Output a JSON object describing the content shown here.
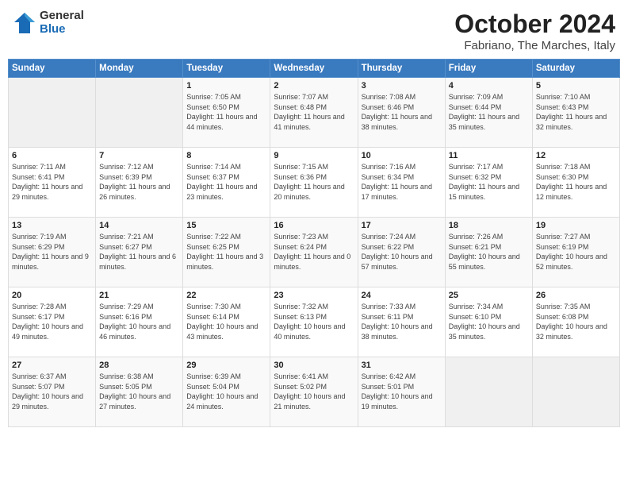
{
  "header": {
    "logo_general": "General",
    "logo_blue": "Blue",
    "month_title": "October 2024",
    "location": "Fabriano, The Marches, Italy"
  },
  "days_of_week": [
    "Sunday",
    "Monday",
    "Tuesday",
    "Wednesday",
    "Thursday",
    "Friday",
    "Saturday"
  ],
  "weeks": [
    [
      {
        "num": "",
        "sunrise": "",
        "sunset": "",
        "daylight": ""
      },
      {
        "num": "",
        "sunrise": "",
        "sunset": "",
        "daylight": ""
      },
      {
        "num": "1",
        "sunrise": "Sunrise: 7:05 AM",
        "sunset": "Sunset: 6:50 PM",
        "daylight": "Daylight: 11 hours and 44 minutes."
      },
      {
        "num": "2",
        "sunrise": "Sunrise: 7:07 AM",
        "sunset": "Sunset: 6:48 PM",
        "daylight": "Daylight: 11 hours and 41 minutes."
      },
      {
        "num": "3",
        "sunrise": "Sunrise: 7:08 AM",
        "sunset": "Sunset: 6:46 PM",
        "daylight": "Daylight: 11 hours and 38 minutes."
      },
      {
        "num": "4",
        "sunrise": "Sunrise: 7:09 AM",
        "sunset": "Sunset: 6:44 PM",
        "daylight": "Daylight: 11 hours and 35 minutes."
      },
      {
        "num": "5",
        "sunrise": "Sunrise: 7:10 AM",
        "sunset": "Sunset: 6:43 PM",
        "daylight": "Daylight: 11 hours and 32 minutes."
      }
    ],
    [
      {
        "num": "6",
        "sunrise": "Sunrise: 7:11 AM",
        "sunset": "Sunset: 6:41 PM",
        "daylight": "Daylight: 11 hours and 29 minutes."
      },
      {
        "num": "7",
        "sunrise": "Sunrise: 7:12 AM",
        "sunset": "Sunset: 6:39 PM",
        "daylight": "Daylight: 11 hours and 26 minutes."
      },
      {
        "num": "8",
        "sunrise": "Sunrise: 7:14 AM",
        "sunset": "Sunset: 6:37 PM",
        "daylight": "Daylight: 11 hours and 23 minutes."
      },
      {
        "num": "9",
        "sunrise": "Sunrise: 7:15 AM",
        "sunset": "Sunset: 6:36 PM",
        "daylight": "Daylight: 11 hours and 20 minutes."
      },
      {
        "num": "10",
        "sunrise": "Sunrise: 7:16 AM",
        "sunset": "Sunset: 6:34 PM",
        "daylight": "Daylight: 11 hours and 17 minutes."
      },
      {
        "num": "11",
        "sunrise": "Sunrise: 7:17 AM",
        "sunset": "Sunset: 6:32 PM",
        "daylight": "Daylight: 11 hours and 15 minutes."
      },
      {
        "num": "12",
        "sunrise": "Sunrise: 7:18 AM",
        "sunset": "Sunset: 6:30 PM",
        "daylight": "Daylight: 11 hours and 12 minutes."
      }
    ],
    [
      {
        "num": "13",
        "sunrise": "Sunrise: 7:19 AM",
        "sunset": "Sunset: 6:29 PM",
        "daylight": "Daylight: 11 hours and 9 minutes."
      },
      {
        "num": "14",
        "sunrise": "Sunrise: 7:21 AM",
        "sunset": "Sunset: 6:27 PM",
        "daylight": "Daylight: 11 hours and 6 minutes."
      },
      {
        "num": "15",
        "sunrise": "Sunrise: 7:22 AM",
        "sunset": "Sunset: 6:25 PM",
        "daylight": "Daylight: 11 hours and 3 minutes."
      },
      {
        "num": "16",
        "sunrise": "Sunrise: 7:23 AM",
        "sunset": "Sunset: 6:24 PM",
        "daylight": "Daylight: 11 hours and 0 minutes."
      },
      {
        "num": "17",
        "sunrise": "Sunrise: 7:24 AM",
        "sunset": "Sunset: 6:22 PM",
        "daylight": "Daylight: 10 hours and 57 minutes."
      },
      {
        "num": "18",
        "sunrise": "Sunrise: 7:26 AM",
        "sunset": "Sunset: 6:21 PM",
        "daylight": "Daylight: 10 hours and 55 minutes."
      },
      {
        "num": "19",
        "sunrise": "Sunrise: 7:27 AM",
        "sunset": "Sunset: 6:19 PM",
        "daylight": "Daylight: 10 hours and 52 minutes."
      }
    ],
    [
      {
        "num": "20",
        "sunrise": "Sunrise: 7:28 AM",
        "sunset": "Sunset: 6:17 PM",
        "daylight": "Daylight: 10 hours and 49 minutes."
      },
      {
        "num": "21",
        "sunrise": "Sunrise: 7:29 AM",
        "sunset": "Sunset: 6:16 PM",
        "daylight": "Daylight: 10 hours and 46 minutes."
      },
      {
        "num": "22",
        "sunrise": "Sunrise: 7:30 AM",
        "sunset": "Sunset: 6:14 PM",
        "daylight": "Daylight: 10 hours and 43 minutes."
      },
      {
        "num": "23",
        "sunrise": "Sunrise: 7:32 AM",
        "sunset": "Sunset: 6:13 PM",
        "daylight": "Daylight: 10 hours and 40 minutes."
      },
      {
        "num": "24",
        "sunrise": "Sunrise: 7:33 AM",
        "sunset": "Sunset: 6:11 PM",
        "daylight": "Daylight: 10 hours and 38 minutes."
      },
      {
        "num": "25",
        "sunrise": "Sunrise: 7:34 AM",
        "sunset": "Sunset: 6:10 PM",
        "daylight": "Daylight: 10 hours and 35 minutes."
      },
      {
        "num": "26",
        "sunrise": "Sunrise: 7:35 AM",
        "sunset": "Sunset: 6:08 PM",
        "daylight": "Daylight: 10 hours and 32 minutes."
      }
    ],
    [
      {
        "num": "27",
        "sunrise": "Sunrise: 6:37 AM",
        "sunset": "Sunset: 5:07 PM",
        "daylight": "Daylight: 10 hours and 29 minutes."
      },
      {
        "num": "28",
        "sunrise": "Sunrise: 6:38 AM",
        "sunset": "Sunset: 5:05 PM",
        "daylight": "Daylight: 10 hours and 27 minutes."
      },
      {
        "num": "29",
        "sunrise": "Sunrise: 6:39 AM",
        "sunset": "Sunset: 5:04 PM",
        "daylight": "Daylight: 10 hours and 24 minutes."
      },
      {
        "num": "30",
        "sunrise": "Sunrise: 6:41 AM",
        "sunset": "Sunset: 5:02 PM",
        "daylight": "Daylight: 10 hours and 21 minutes."
      },
      {
        "num": "31",
        "sunrise": "Sunrise: 6:42 AM",
        "sunset": "Sunset: 5:01 PM",
        "daylight": "Daylight: 10 hours and 19 minutes."
      },
      {
        "num": "",
        "sunrise": "",
        "sunset": "",
        "daylight": ""
      },
      {
        "num": "",
        "sunrise": "",
        "sunset": "",
        "daylight": ""
      }
    ]
  ]
}
